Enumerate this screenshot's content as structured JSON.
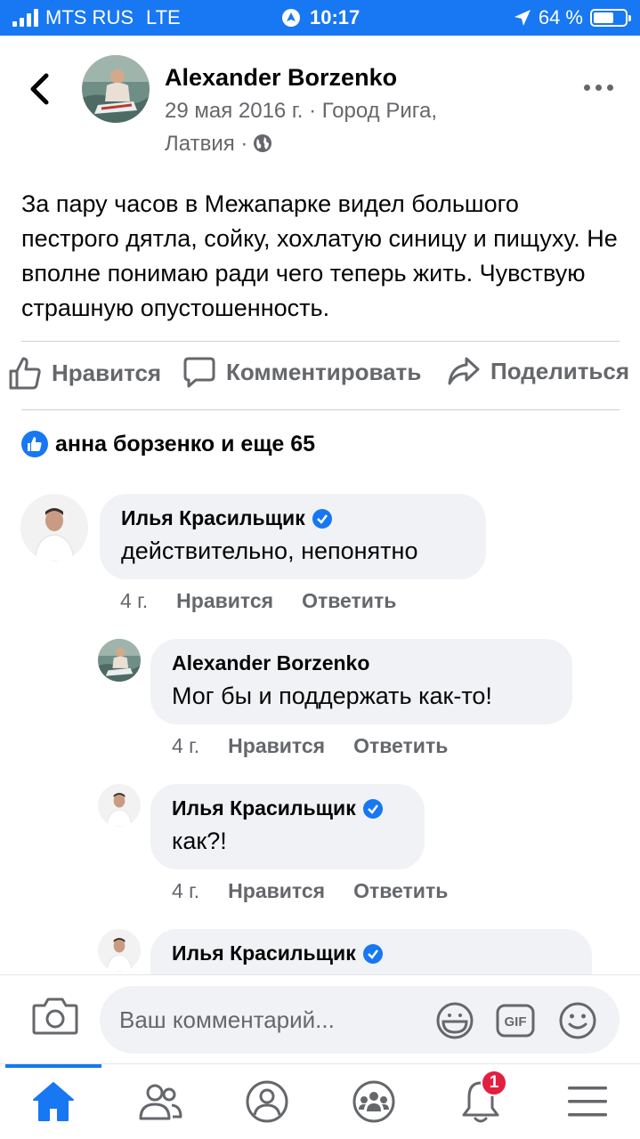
{
  "status_bar": {
    "carrier": "MTS RUS",
    "network": "LTE",
    "time": "10:17",
    "battery": "64 %",
    "battery_level": 0.64
  },
  "post": {
    "author": "Alexander Borzenko",
    "meta_line1": "29 мая 2016 г. · Город Рига,",
    "meta_line2": "Латвия ·",
    "text": "За пару часов в Межапарке видел большого пестрого дятла, сойку, хохлатую синицу и пищуху. Не вполне понимаю ради чего теперь жить. Чувствую страшную опустошенность.",
    "actions": {
      "like": "Нравится",
      "comment": "Комментировать",
      "share": "Поделиться"
    },
    "reactions_summary": "анна борзенко и еще 65"
  },
  "comments": [
    {
      "author": "Илья Красильщик",
      "verified": true,
      "text": "действительно, непонятно",
      "time": "4 г.",
      "like": "Нравится",
      "reply": "Ответить"
    },
    {
      "author": "Alexander Borzenko",
      "verified": false,
      "text": "Мог бы и поддержать как-то!",
      "time": "4 г.",
      "like": "Нравится",
      "reply": "Ответить"
    },
    {
      "author": "Илья Красильщик",
      "verified": true,
      "text": "как?!",
      "time": "4 г.",
      "like": "Нравится",
      "reply": "Ответить"
    },
    {
      "author": "Илья Красильщик",
      "verified": true
    }
  ],
  "composer": {
    "placeholder": "Ваш комментарий...",
    "gif_label": "GIF"
  },
  "tabbar": {
    "active": "home",
    "notifications_badge": "1",
    "icons": [
      "home-icon",
      "friends-icon",
      "profile-icon",
      "groups-icon",
      "bell-icon",
      "menu-icon"
    ]
  },
  "colors": {
    "brand": "#1877f2",
    "secondary_text": "#65676b",
    "bubble": "#f0f2f5",
    "badge": "#e41e3f"
  }
}
